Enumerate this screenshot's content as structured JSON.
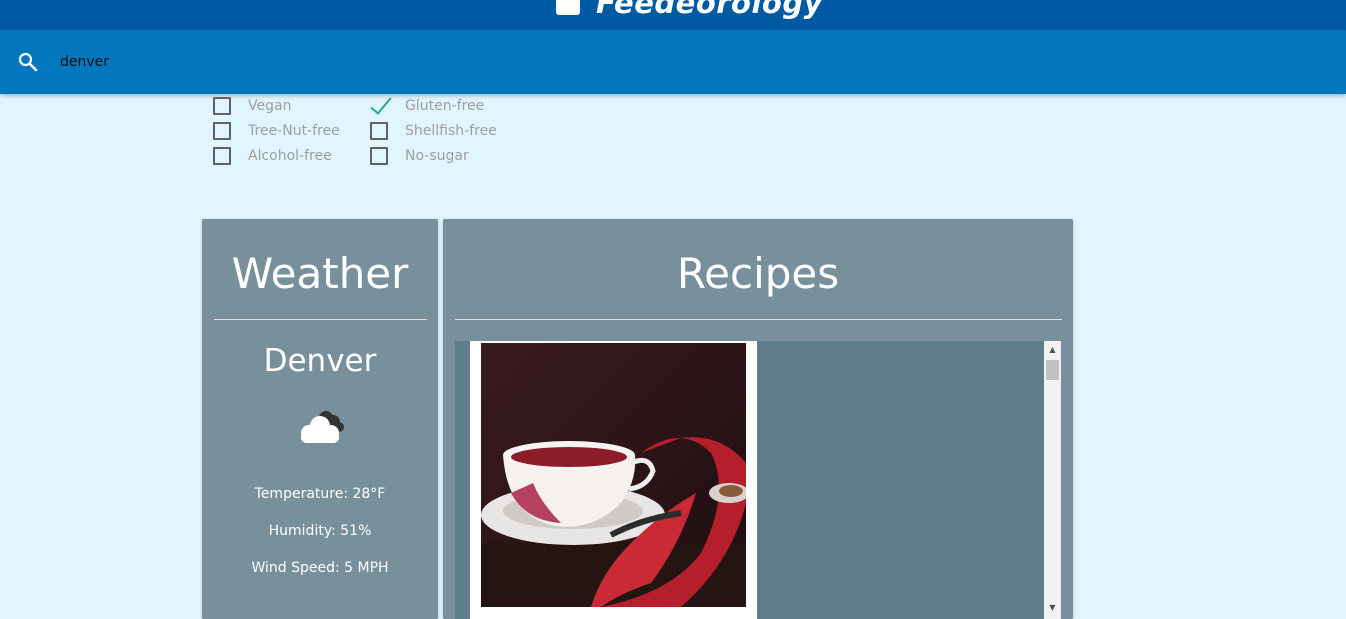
{
  "header": {
    "app_name": "Feedeorology"
  },
  "search": {
    "value": "denver",
    "icon": "search-icon"
  },
  "filters": [
    {
      "label": "Vegan",
      "checked": false
    },
    {
      "label": "Gluten-free",
      "checked": true
    },
    {
      "label": "Tree-Nut-free",
      "checked": false
    },
    {
      "label": "Shellfish-free",
      "checked": false
    },
    {
      "label": "Alcohol-free",
      "checked": false
    },
    {
      "label": "No-sugar",
      "checked": false
    }
  ],
  "weather": {
    "title": "Weather",
    "city": "Denver",
    "icon": "cloudy-icon",
    "temperature": "Temperature: 28°F",
    "humidity": "Humidity: 51%",
    "wind": "Wind Speed: 5 MPH"
  },
  "recipes": {
    "title": "Recipes",
    "items": [
      {
        "image": "recipe-photo-tea"
      }
    ]
  },
  "colors": {
    "topbar": "#0059a3",
    "searchbar": "#0277bd",
    "background": "#e1f5fe",
    "card": "#78909c",
    "recipe_area": "#607d8b",
    "check": "#26a69a"
  }
}
